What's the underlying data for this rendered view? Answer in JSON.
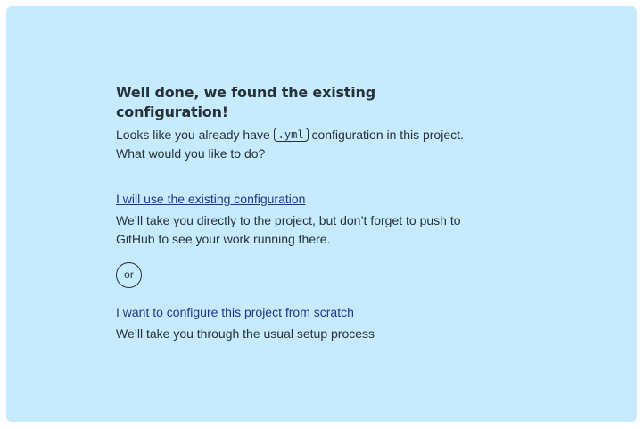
{
  "heading": "Well done, we found the existing configuration!",
  "intro": {
    "before_code": "Looks like you already have",
    "code": ".yml",
    "after_code": "configuration in this project.",
    "question": "What would you like to do?"
  },
  "options": [
    {
      "link": "I will use the existing configuration",
      "description": "We’ll take you directly to the project, but don’t forget to push to GitHub to see your work running there."
    },
    {
      "link": "I want to configure this project from scratch",
      "description": "We’ll take you through the usual setup process"
    }
  ],
  "separator": "or",
  "colors": {
    "panel_background": "#c6ebfe",
    "text": "#263238",
    "link": "#1b3a8a"
  }
}
